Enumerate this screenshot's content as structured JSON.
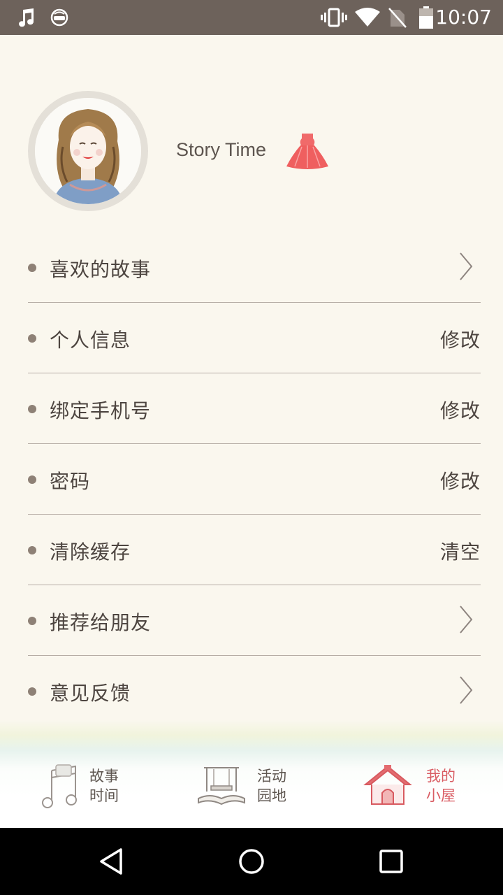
{
  "status_bar": {
    "time": "10:07",
    "icons": [
      "music-note-icon",
      "face-mask-icon",
      "vibrate-icon",
      "wifi-icon",
      "no-sim-icon",
      "battery-icon"
    ]
  },
  "profile": {
    "username": "Story Time",
    "badge_icon": "dress-icon"
  },
  "menu": [
    {
      "label": "喜欢的故事",
      "action": "",
      "icon": "chevron-right-icon"
    },
    {
      "label": "个人信息",
      "action": "修改"
    },
    {
      "label": "绑定手机号",
      "action": "修改"
    },
    {
      "label": "密码",
      "action": "修改"
    },
    {
      "label": "清除缓存",
      "action": "清空"
    },
    {
      "label": "推荐给朋友",
      "action": "",
      "icon": "chevron-right-icon"
    },
    {
      "label": "意见反馈",
      "action": "",
      "icon": "chevron-right-icon"
    }
  ],
  "tabs": [
    {
      "line1": "故事",
      "line2": "时间",
      "icon": "music-notes-icon",
      "active": false
    },
    {
      "line1": "活动",
      "line2": "园地",
      "icon": "swing-book-icon",
      "active": false
    },
    {
      "line1": "我的",
      "line2": "小屋",
      "icon": "house-icon",
      "active": true
    }
  ],
  "colors": {
    "background": "#faf7ee",
    "status_bar": "#6d625b",
    "active_tab": "#d95c63",
    "text": "#4d4540"
  }
}
